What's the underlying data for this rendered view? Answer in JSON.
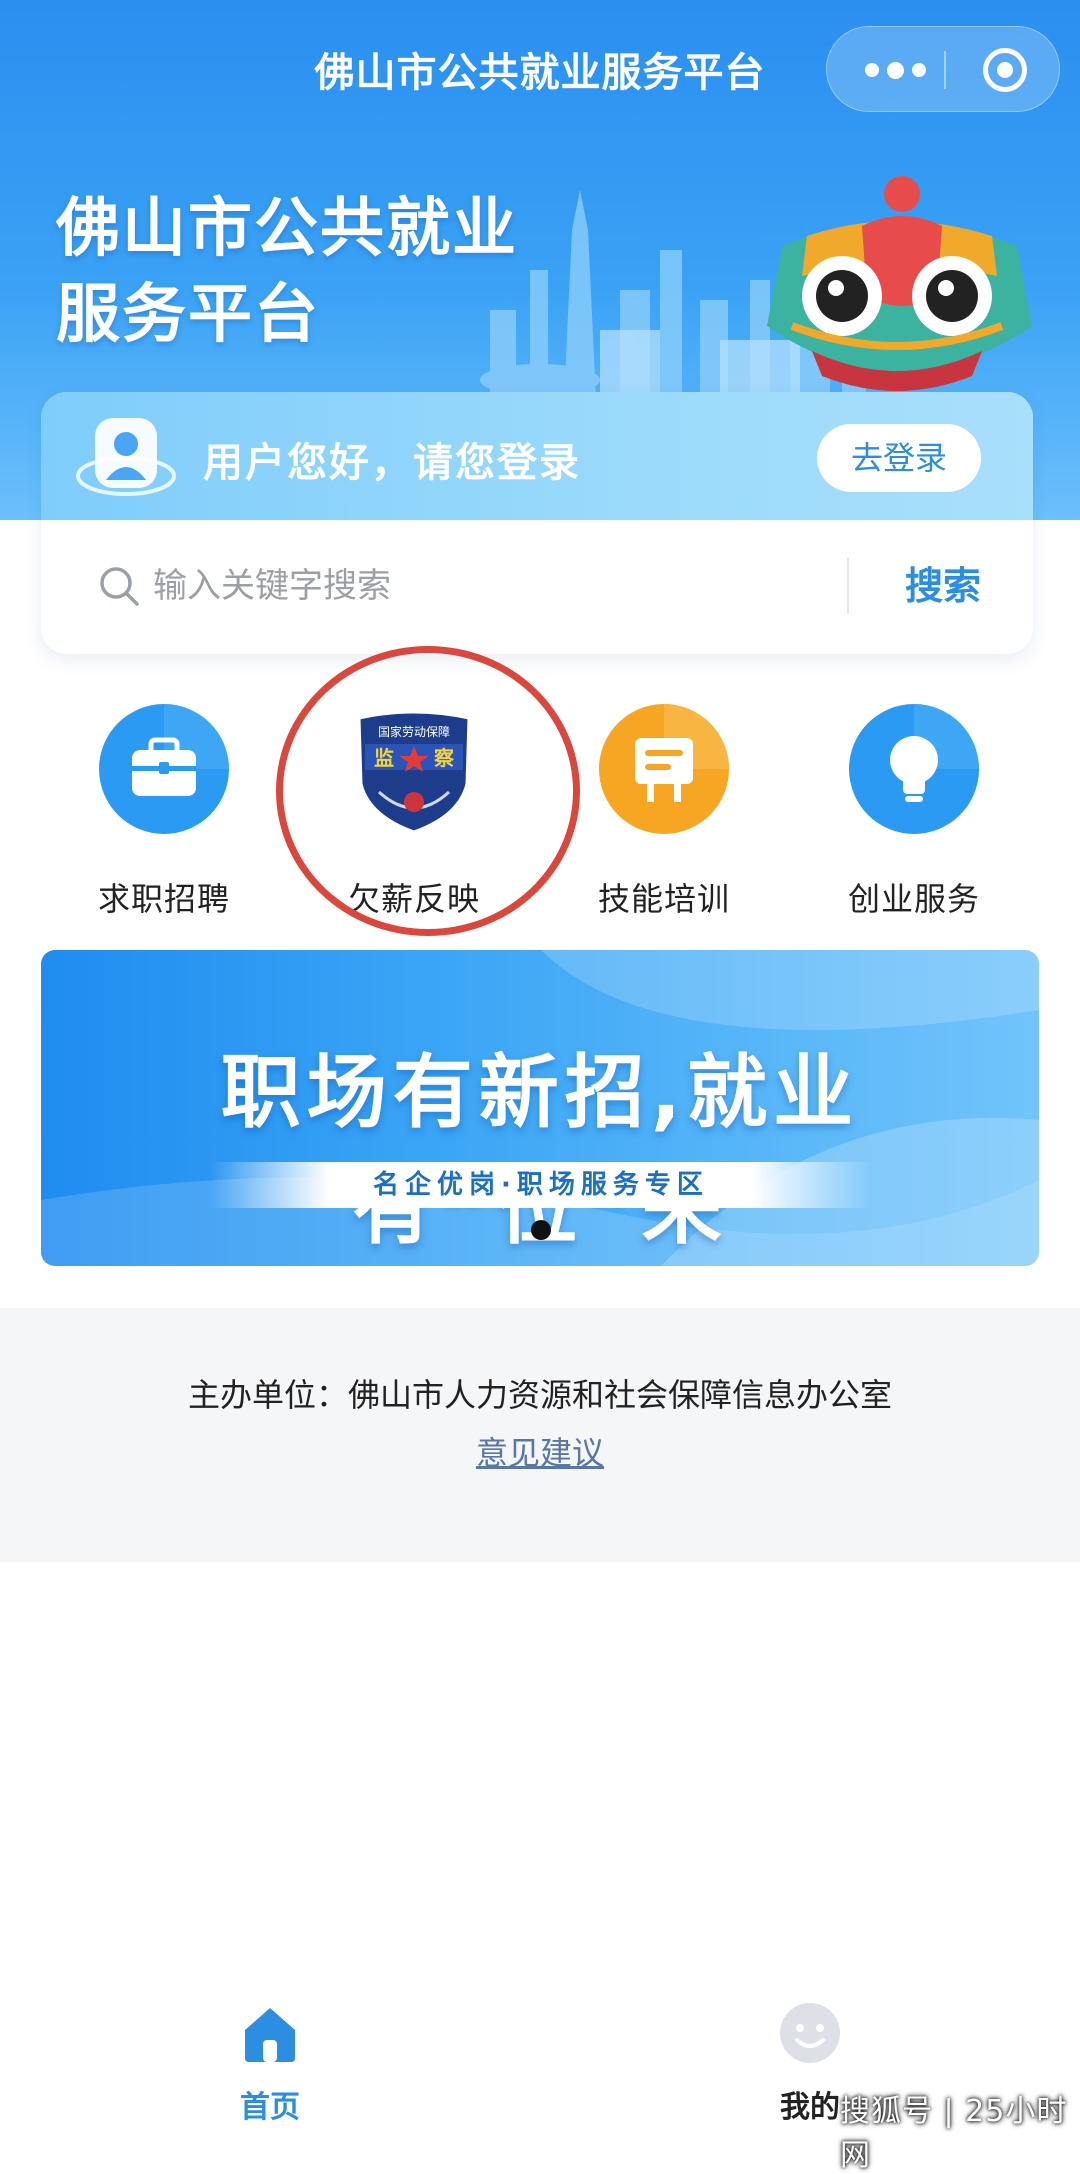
{
  "header": {
    "nav_title": "佛山市公共就业服务平台",
    "title_line1": "佛山市公共就业",
    "title_line2": "服务平台",
    "menu_icon": "more-dots-icon",
    "close_icon": "target-circle-icon"
  },
  "login": {
    "greeting": "用户您好，请您登录",
    "button": "去登录"
  },
  "search": {
    "placeholder": "输入关键字搜索",
    "button": "搜索"
  },
  "services": [
    {
      "label": "求职招聘",
      "icon": "briefcase-icon",
      "color": "#2a9af2"
    },
    {
      "label": "欠薪反映",
      "icon": "labor-inspection-badge-icon",
      "badge_top": "国家劳动保障",
      "badge_mid": "监",
      "badge_mid2": "察"
    },
    {
      "label": "技能培训",
      "icon": "presentation-board-icon",
      "color": "#f7a623"
    },
    {
      "label": "创业服务",
      "icon": "lightbulb-icon",
      "color": "#2a9af2"
    }
  ],
  "banner": {
    "headline": "职场有新招,就业有“位”来",
    "subline": "名企优岗·职场服务专区"
  },
  "footer": {
    "host": "主办单位：佛山市人力资源和社会保障信息办公室",
    "feedback": "意见建议"
  },
  "tabbar": [
    {
      "label": "首页",
      "icon": "home-icon",
      "active": true
    },
    {
      "label": "我的",
      "icon": "smiley-icon",
      "active": false
    }
  ],
  "watermark": "搜狐号 | 25小时网",
  "colors": {
    "primary": "#2b8ee0",
    "highlight_ring": "#d9473d"
  }
}
